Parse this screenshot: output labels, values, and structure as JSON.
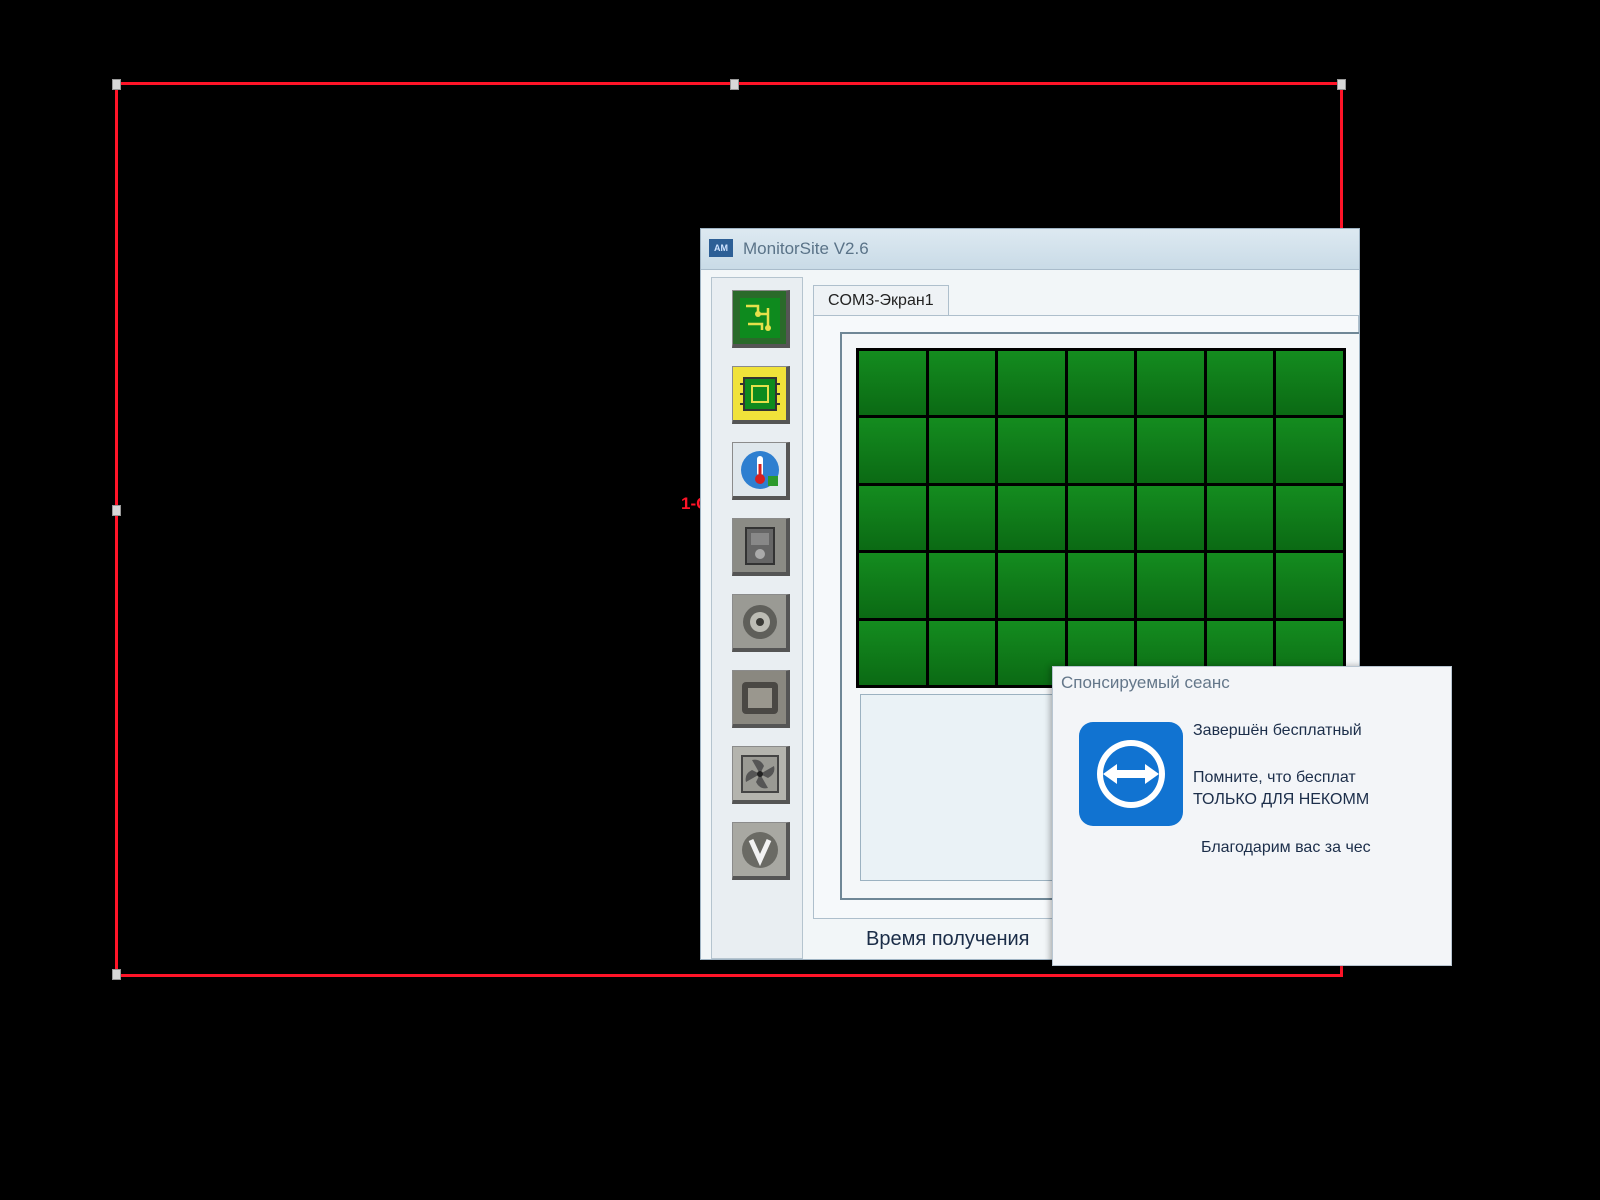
{
  "outline": {
    "label": "1-C"
  },
  "window": {
    "title": "MonitorSite V2.6",
    "app_icon_text": "AM"
  },
  "toolbar": {
    "tools": [
      {
        "name": "circuit-board-green-icon"
      },
      {
        "name": "circuit-board-yellow-icon"
      },
      {
        "name": "thermometer-icon"
      },
      {
        "name": "cabinet-icon"
      },
      {
        "name": "gauge-icon"
      },
      {
        "name": "device-icon"
      },
      {
        "name": "fan-icon"
      },
      {
        "name": "valve-icon"
      }
    ]
  },
  "tab": {
    "label": "COM3-Экран1"
  },
  "bottom_label": "Время получения",
  "popup": {
    "title": "Спонсируемый сеанс",
    "line1": "Завершён бесплатный",
    "line2": "Помните, что бесплат",
    "line3": "ТОЛЬКО ДЛЯ НЕКОММ",
    "line4": "Благодарим вас за чес"
  },
  "colors": {
    "outline": "#ff1428",
    "grid_cell": "#148c1f",
    "active_tool": "#f1e23a",
    "teamviewer_blue": "#1173d1"
  }
}
